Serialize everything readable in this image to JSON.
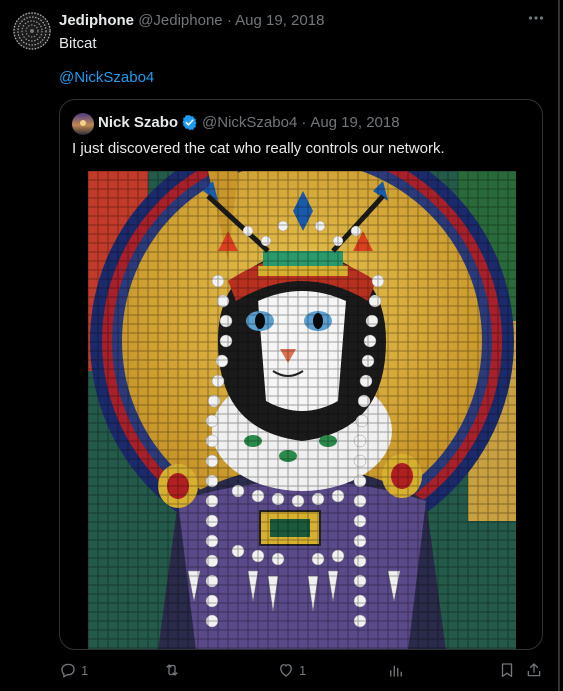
{
  "tweet": {
    "author_name": "Jediphone",
    "author_handle": "@Jediphone",
    "separator": "·",
    "date": "Aug 19, 2018",
    "text": "Bitcat",
    "mention": "@NickSzabo4",
    "more_icon": "more-horizontal-icon"
  },
  "quoted": {
    "author_name": "Nick Szabo",
    "author_handle": "@NickSzabo4",
    "separator": "·",
    "date": "Aug 19, 2018",
    "text": "I just discovered the cat who really controls our network.",
    "verified_icon": "verified-badge-icon",
    "image": "mosaic-cat-with-crown-and-pearls"
  },
  "actions": {
    "reply_count": "1",
    "retweet_count": "",
    "like_count": "1",
    "icons": [
      "reply-icon",
      "retweet-icon",
      "like-icon",
      "views-icon",
      "bookmark-icon",
      "share-icon"
    ]
  },
  "colors": {
    "background": "#000000",
    "text": "#e7e9ea",
    "muted": "#71767b",
    "link": "#1d9bf0",
    "border": "#2f3336"
  }
}
